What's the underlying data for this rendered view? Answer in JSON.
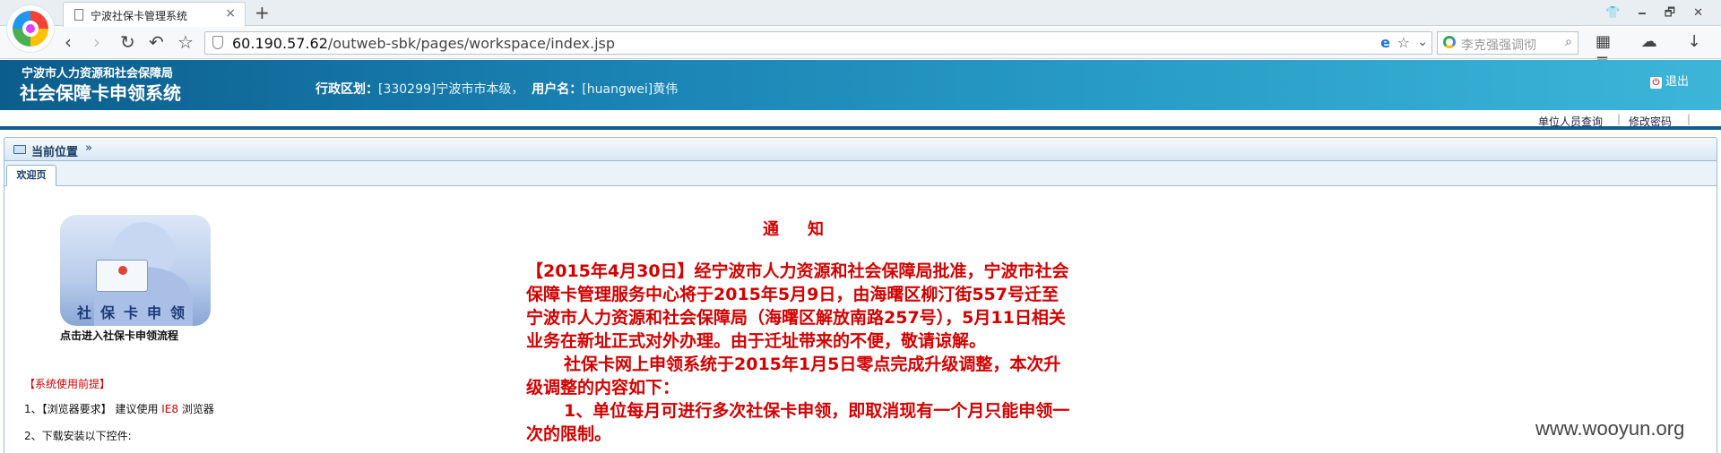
{
  "browser": {
    "tab_title": "宁波社保卡管理系统",
    "tab_close": "×",
    "new_tab": "+",
    "window_controls": "👕 🗕 🗗 ✕",
    "url_host": "60.190.57.62",
    "url_path": "/outweb-sbk/pages/workspace/index.jsp",
    "search_placeholder": "李克强强调彻",
    "nav": {
      "back": "‹",
      "forward": "›",
      "reload": "↻",
      "undo": "↶",
      "star": "☆"
    },
    "icons": [
      "grid-icon",
      "cloud-icon",
      "download-icon",
      "menu-icon"
    ]
  },
  "header": {
    "org": "宁波市人力资源和社会保障局",
    "title": "社会保障卡申领系统",
    "region_label": "行政区划：",
    "region_value": "[330299]宁波市市本级，",
    "user_label": "用户名：",
    "user_value": "[huangwei]黄伟",
    "logout": "退出"
  },
  "sublinks": {
    "staff_query": "单位人员查询",
    "change_password": "修改密码",
    "sep": "|"
  },
  "breadcrumb": {
    "label": "当前位置",
    "arrows": "»"
  },
  "tabs": {
    "welcome": "欢迎页"
  },
  "left": {
    "card_banner": "社保卡申领",
    "card_caption": "点击进入社保卡申领流程",
    "prereq_title": "【系统使用前提】",
    "prereq_1_prefix": "1、【浏览器要求】 建议使用 ",
    "prereq_1_highlight": "IE8",
    "prereq_1_suffix": " 浏览器",
    "prereq_2": "2、下载安装以下控件:"
  },
  "notice": {
    "title": "通知",
    "para1": "【2015年4月30日】经宁波市人力资源和社会保障局批准，宁波市社会保障卡管理服务中心将于2015年5月9日，由海曙区柳汀街557号迁至宁波市人力资源和社会保障局（海曙区解放南路257号），5月11日相关业务在新址正式对外办理。由于迁址带来的不便，敬请谅解。",
    "para2": "社保卡网上申领系统于2015年1月5日零点完成升级调整，本次升级调整的内容如下：",
    "para3": "1、单位每月可进行多次社保卡申领，即取消现有一个月只能申领一次的限制。"
  },
  "watermark": "www.wooyun.org",
  "colors": {
    "header_start": "#0b5d8c",
    "header_end": "#3db5d9",
    "notice_red": "#d40000"
  }
}
